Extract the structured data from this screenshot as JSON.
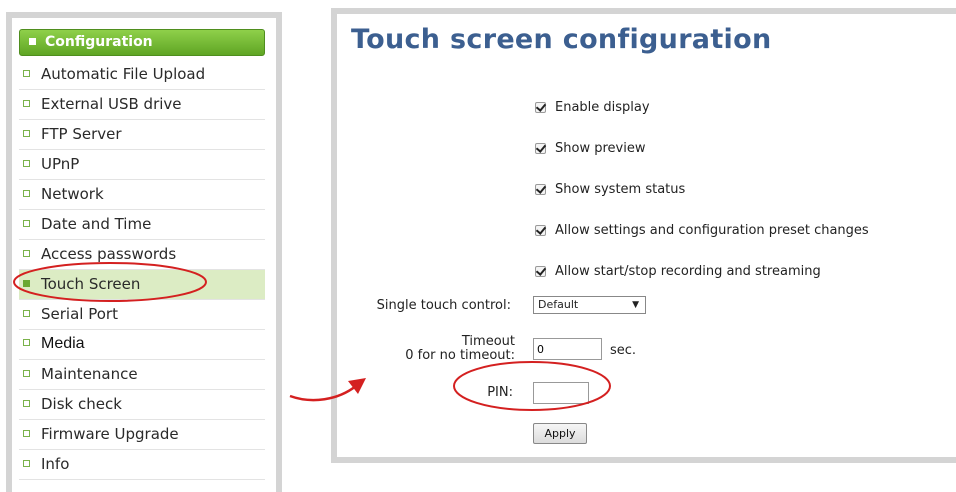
{
  "sidebar": {
    "header": "Configuration",
    "items": [
      {
        "label": "Automatic File Upload"
      },
      {
        "label": "External USB drive"
      },
      {
        "label": "FTP Server"
      },
      {
        "label": "UPnP"
      },
      {
        "label": "Network"
      },
      {
        "label": "Date and Time"
      },
      {
        "label": "Access passwords"
      },
      {
        "label": "Touch Screen"
      },
      {
        "label": "Serial Port"
      },
      {
        "label": "Media"
      },
      {
        "label": "Maintenance"
      },
      {
        "label": "Disk check"
      },
      {
        "label": "Firmware Upgrade"
      },
      {
        "label": "Info"
      }
    ],
    "active_item": "Touch Screen"
  },
  "main": {
    "title": "Touch screen configuration",
    "checkboxes": [
      {
        "label": "Enable display",
        "checked": true
      },
      {
        "label": "Show preview",
        "checked": true
      },
      {
        "label": "Show system status",
        "checked": true
      },
      {
        "label": "Allow settings and configuration preset changes",
        "checked": true
      },
      {
        "label": "Allow start/stop recording and streaming",
        "checked": true
      }
    ],
    "single_touch": {
      "label": "Single touch control:",
      "value": "Default"
    },
    "timeout": {
      "label_line1": "Timeout",
      "label_line2": "0 for no timeout:",
      "value": "0",
      "unit": "sec."
    },
    "pin": {
      "label": "PIN:",
      "value": ""
    },
    "apply_label": "Apply"
  },
  "colors": {
    "accent_green": "#6aa832",
    "title_blue": "#3c5f90",
    "annotation_red": "#d42020"
  }
}
